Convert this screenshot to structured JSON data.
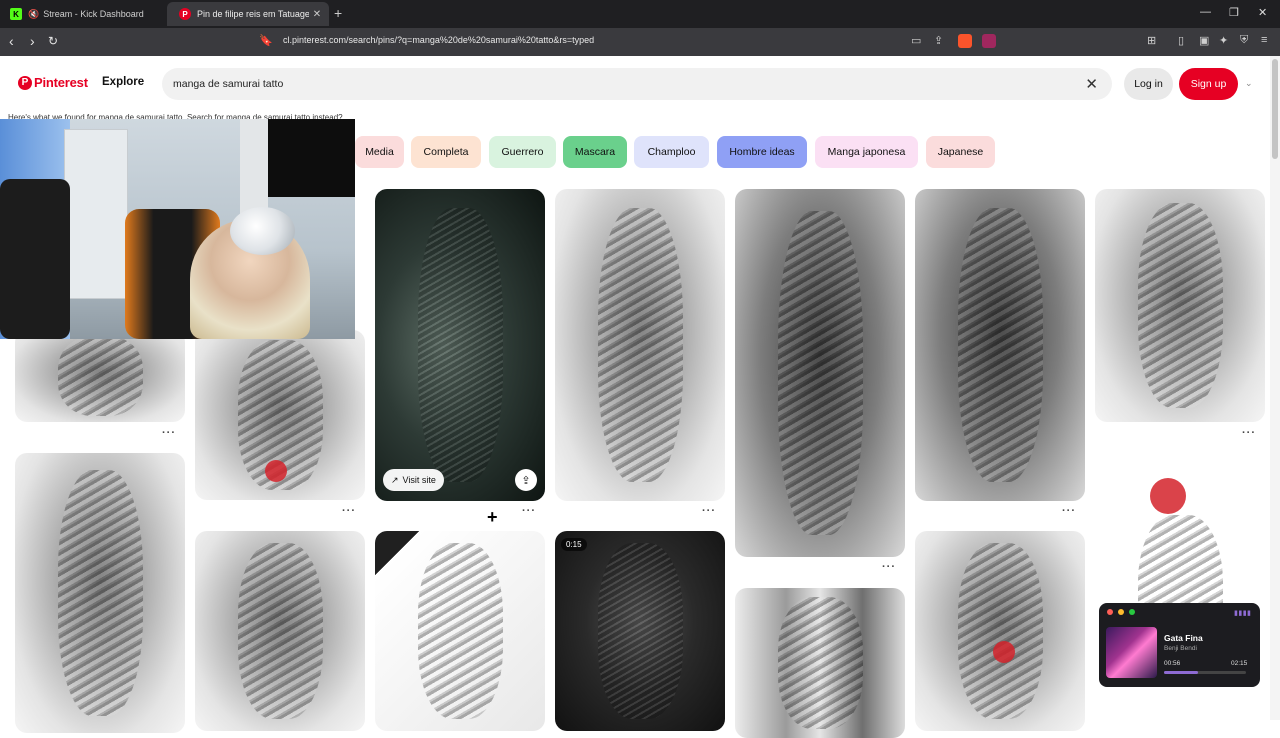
{
  "browser": {
    "tabs": [
      {
        "title": "Stream - Kick Dashboard",
        "favicon": "kick-icon",
        "muted": true,
        "active": false
      },
      {
        "title": "Pin de filipe reis em Tatuagem | T",
        "favicon": "pinterest-icon",
        "active": true
      }
    ],
    "url": "cl.pinterest.com/search/pins/?q=manga%20de%20samurai%20tatto&rs=typed",
    "colors": {
      "tabbar": "#1f1f22",
      "toolbar": "#3a3a3e"
    }
  },
  "header": {
    "logo": "Pinterest",
    "explore": "Explore",
    "search_value": "manga de samurai tatto",
    "login": "Log in",
    "signup": "Sign up",
    "brand_color": "#e60023"
  },
  "results_note": "Here's what we found for manga de samurai tatto. Search for manga de samurai tatto instead?",
  "chips": [
    {
      "label": "Media",
      "color": "#fbdcdc"
    },
    {
      "label": "Completa",
      "color": "#fde3d2"
    },
    {
      "label": "Guerrero",
      "color": "#d9f3df"
    },
    {
      "label": "Mascara",
      "color": "#6ad08c"
    },
    {
      "label": "Champloo",
      "color": "#dfe3fb"
    },
    {
      "label": "Hombre ideas",
      "color": "#8fa0f5"
    },
    {
      "label": "Manga japonesa",
      "color": "#fbe0f4"
    },
    {
      "label": "Japanese",
      "color": "#fbdcdc"
    }
  ],
  "pins": {
    "visit_site": "Visit site",
    "video_duration": "0:15",
    "more": "···"
  },
  "music": {
    "song": "Gata Fina",
    "artist": "Benji Bendi",
    "elapsed": "00:56",
    "total": "02:15",
    "progress": 0.41
  }
}
